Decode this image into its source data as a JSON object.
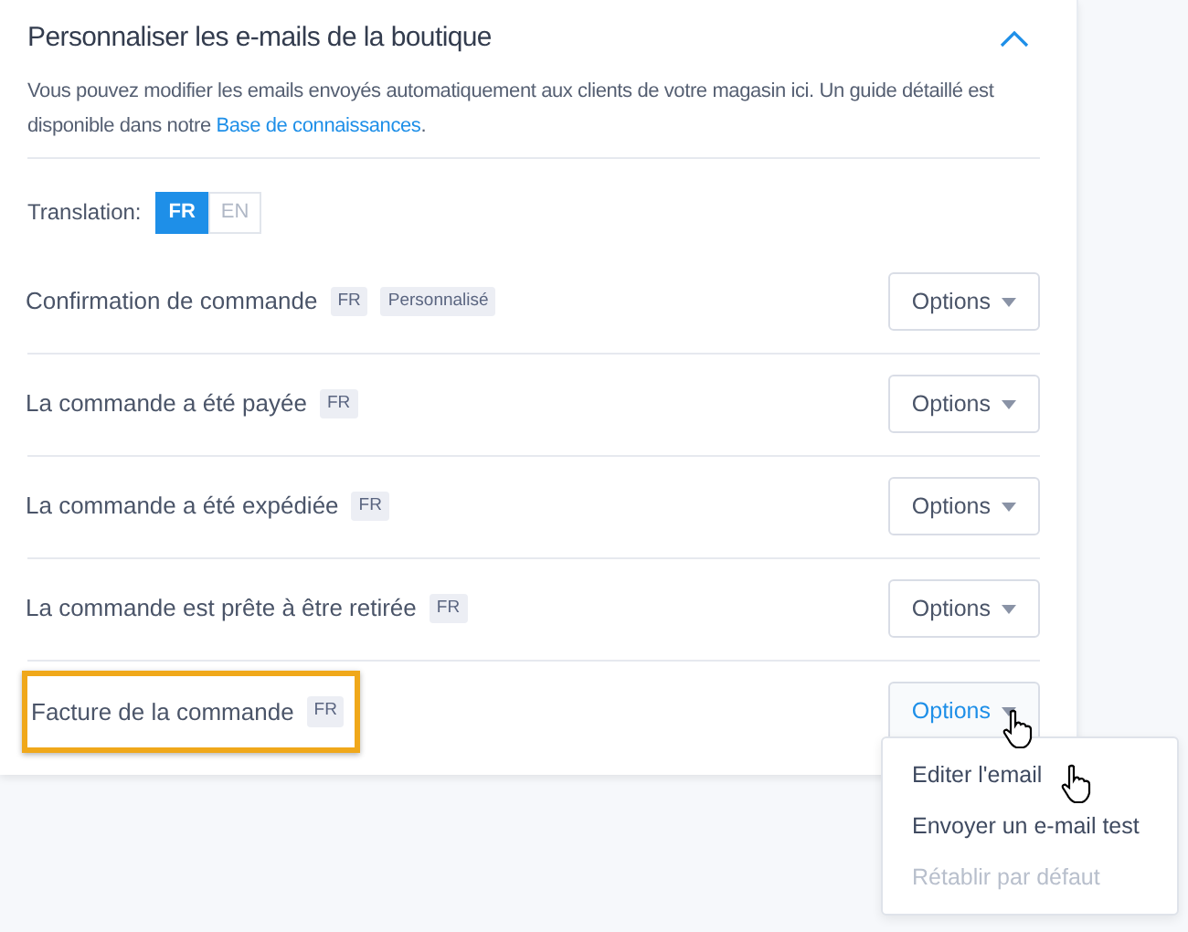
{
  "panel": {
    "title": "Personnaliser les e-mails de la boutique",
    "expanded": true,
    "description": "Vous pouvez modifier les emails envoyés automatiquement aux clients de votre magasin ici. Un guide détaillé est disponible dans notre ",
    "link": "Base de connaissances",
    "description_end": "."
  },
  "translation": {
    "label": "Translation:",
    "options": [
      {
        "label": "FR",
        "selected": true
      },
      {
        "label": "EN",
        "selected": false
      }
    ]
  },
  "emails": [
    {
      "name": "Confirmation de commande",
      "tags": [
        "FR",
        "Personnalisé"
      ],
      "button": "Options",
      "active": false,
      "highlighted": false
    },
    {
      "name": "La commande a été payée",
      "tags": [
        "FR"
      ],
      "button": "Options",
      "active": false,
      "highlighted": false
    },
    {
      "name": "La commande a été expédiée",
      "tags": [
        "FR"
      ],
      "button": "Options",
      "active": false,
      "highlighted": false
    },
    {
      "name": "La commande est prête à être retirée",
      "tags": [
        "FR"
      ],
      "button": "Options",
      "active": false,
      "highlighted": false
    },
    {
      "name": "Facture de la commande",
      "tags": [
        "FR"
      ],
      "button": "Options",
      "active": true,
      "highlighted": true
    }
  ],
  "menu": [
    {
      "label": "Editer l'email",
      "disabled": false
    },
    {
      "label": "Envoyer un e-mail test",
      "disabled": false
    },
    {
      "label": "Rétablir par défaut",
      "disabled": true
    }
  ]
}
